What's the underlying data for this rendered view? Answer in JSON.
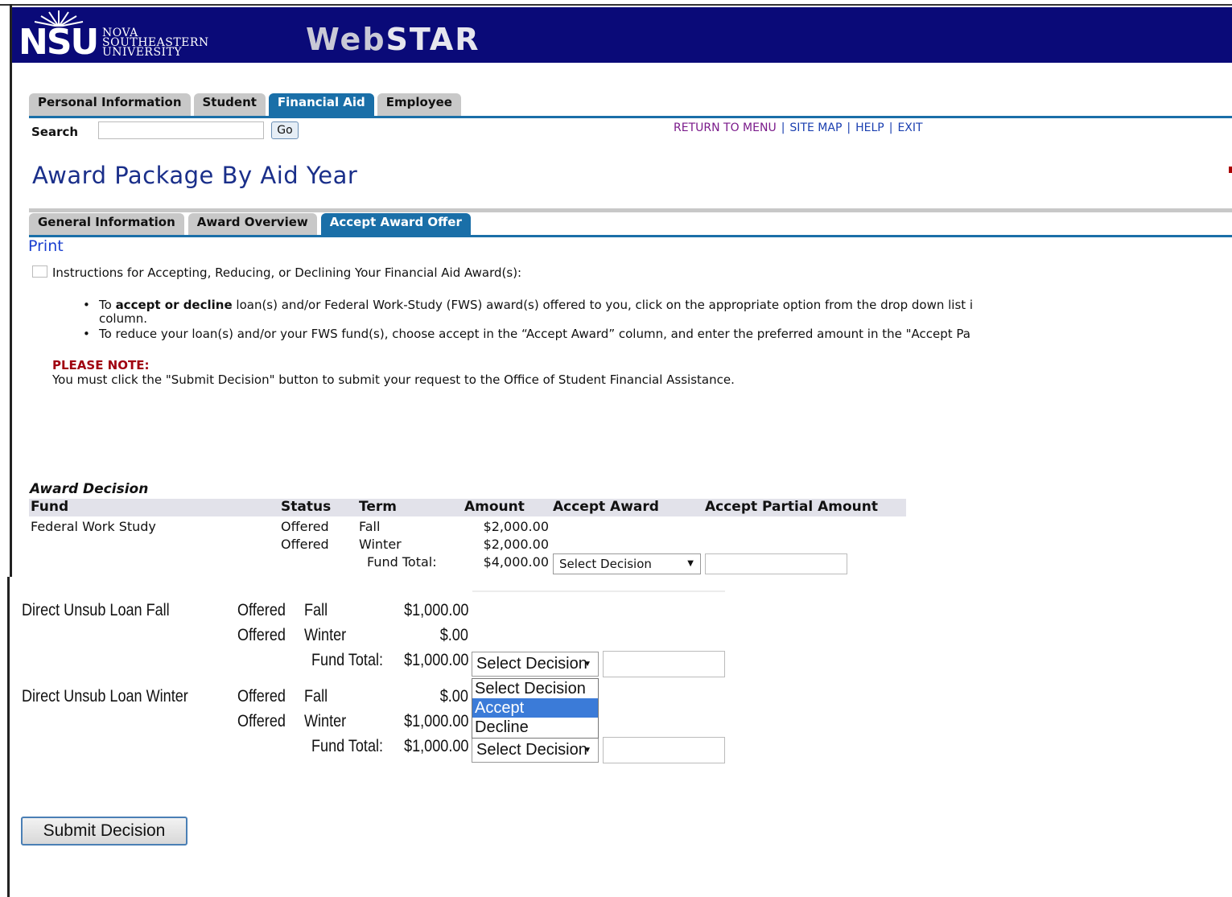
{
  "header": {
    "logo_short": "NSU",
    "logo_name_lines": [
      "NOVA",
      "SOUTHEASTERN",
      "UNIVERSITY"
    ],
    "app_name_part1": "Web",
    "app_name_part2": "STAR"
  },
  "main_tabs": [
    {
      "label": "Personal Information",
      "active": false
    },
    {
      "label": "Student",
      "active": false
    },
    {
      "label": "Financial Aid",
      "active": true
    },
    {
      "label": "Employee",
      "active": false
    }
  ],
  "search": {
    "label": "Search",
    "value": "",
    "go_label": "Go"
  },
  "top_links": {
    "return": "RETURN TO MENU",
    "site_map": "SITE MAP",
    "help": "HELP",
    "exit": "EXIT",
    "separator": "|"
  },
  "page_title": "Award Package By Aid Year",
  "sub_tabs": [
    {
      "label": "General Information",
      "active": false
    },
    {
      "label": "Award Overview",
      "active": false
    },
    {
      "label": "Accept Award Offer",
      "active": true
    }
  ],
  "print_label": "Print",
  "instructions": {
    "heading": "Instructions for Accepting, Reducing, or Declining Your Financial Aid Award(s):",
    "bullet1_pre": "To ",
    "bullet1_bold": "accept or decline",
    "bullet1_post": " loan(s) and/or Federal Work-Study (FWS) award(s) offered to you, click on the appropriate option from the drop down list i",
    "bullet1_wrap": "column.",
    "bullet2": "To reduce your loan(s) and/or your FWS fund(s), choose accept in the “Accept Award” column, and enter the preferred amount in the \"Accept Pa",
    "note_label": "PLEASE NOTE:",
    "note_text": "You must click the \"Submit Decision\" button to submit your request to the Office of Student Financial Assistance."
  },
  "award_decision": {
    "heading": "Award Decision",
    "columns": [
      "Fund",
      "Status",
      "Term",
      "Amount",
      "Accept Award",
      "Accept Partial Amount"
    ],
    "fund_total_label": "Fund Total:",
    "funds": [
      {
        "name": "Federal Work Study",
        "rows": [
          {
            "status": "Offered",
            "term": "Fall",
            "amount": "$2,000.00"
          },
          {
            "status": "Offered",
            "term": "Winter",
            "amount": "$2,000.00"
          }
        ],
        "total": "$4,000.00",
        "decision": "Select Decision",
        "partial": ""
      },
      {
        "name": "Direct Unsub Loan Fall",
        "rows": [
          {
            "status": "Offered",
            "term": "Fall",
            "amount": "$1,000.00"
          },
          {
            "status": "Offered",
            "term": "Winter",
            "amount": "$.00"
          }
        ],
        "total": "$1,000.00",
        "decision": "Select Decision",
        "partial": ""
      },
      {
        "name": "Direct Unsub Loan Winter",
        "rows": [
          {
            "status": "Offered",
            "term": "Fall",
            "amount": "$.00"
          },
          {
            "status": "Offered",
            "term": "Winter",
            "amount": "$1,000.00"
          }
        ],
        "total": "$1,000.00",
        "decision": "Select Decision",
        "partial": ""
      }
    ],
    "dropdown_options": [
      "Select Decision",
      "Accept",
      "Decline"
    ],
    "highlighted_option": "Accept"
  },
  "submit_label": "Submit Decision",
  "colors": {
    "banner": "#0a0a78",
    "tab_active": "#1a6fa8",
    "title": "#1a2f8a",
    "note_red": "#a00010",
    "link_purple": "#7a1a8a",
    "link_blue": "#1a3fb0"
  }
}
